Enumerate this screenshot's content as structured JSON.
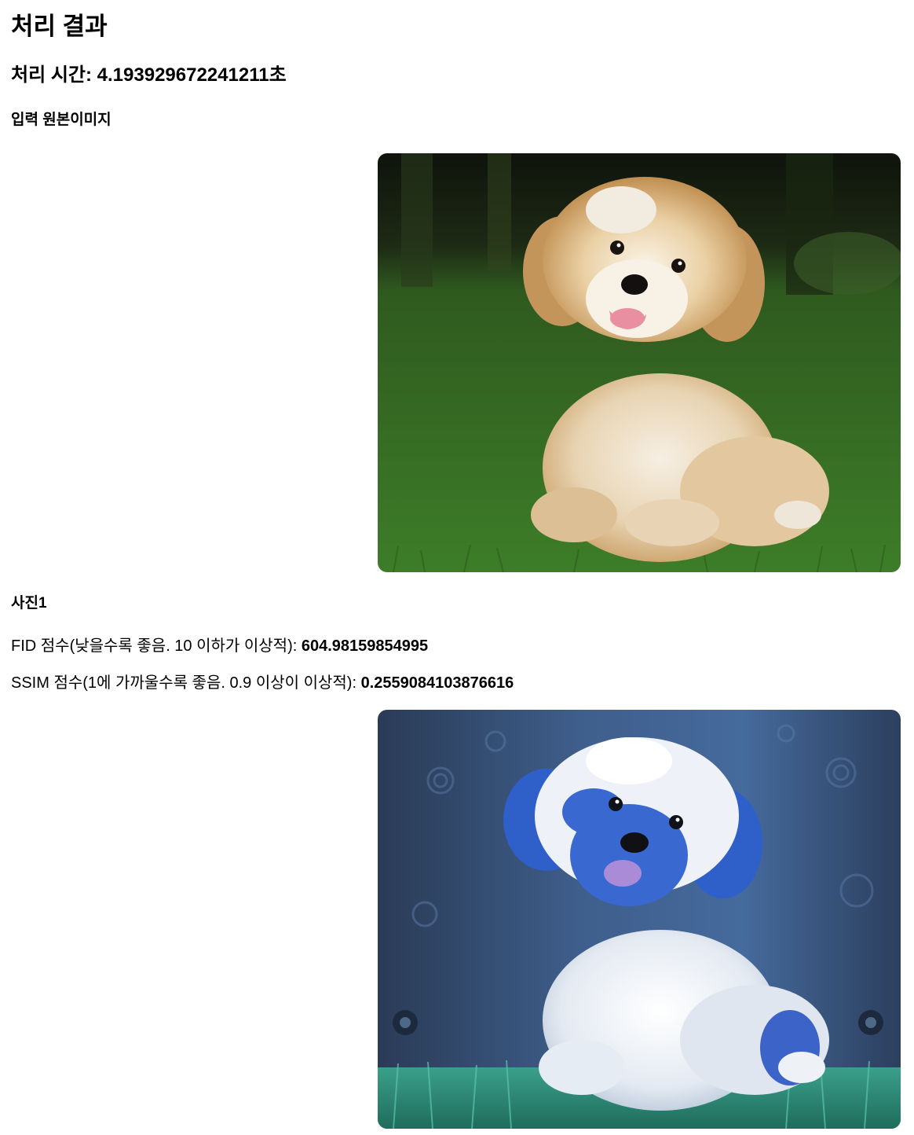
{
  "title": "처리 결과",
  "processing_time": {
    "label": "처리 시간: ",
    "value": "4.193929672241211",
    "unit": "초"
  },
  "original": {
    "heading": "입력 원본이미지",
    "image_icon": "dog-photo-icon"
  },
  "results": [
    {
      "heading": "사진1",
      "fid": {
        "label": "FID 점수(낮을수록 좋음. 10 이하가 이상적): ",
        "value": "604.98159854995"
      },
      "ssim": {
        "label": "SSIM 점수(1에 가까울수록 좋음. 0.9 이상이 이상적): ",
        "value": "0.2559084103876616"
      },
      "image_icon": "stylized-dog-photo-icon"
    }
  ],
  "colors": {
    "grass": "#3f7f2a",
    "grass_dark": "#2b5c1c",
    "background_dark": "#151a10",
    "dog_tan": "#d4b486",
    "dog_cream": "#f1e8da",
    "stylized_bg": "#3b5a86",
    "stylized_blue": "#2f5fc9",
    "stylized_white": "#e8edf4",
    "stylized_grass": "#2e8d7b"
  }
}
